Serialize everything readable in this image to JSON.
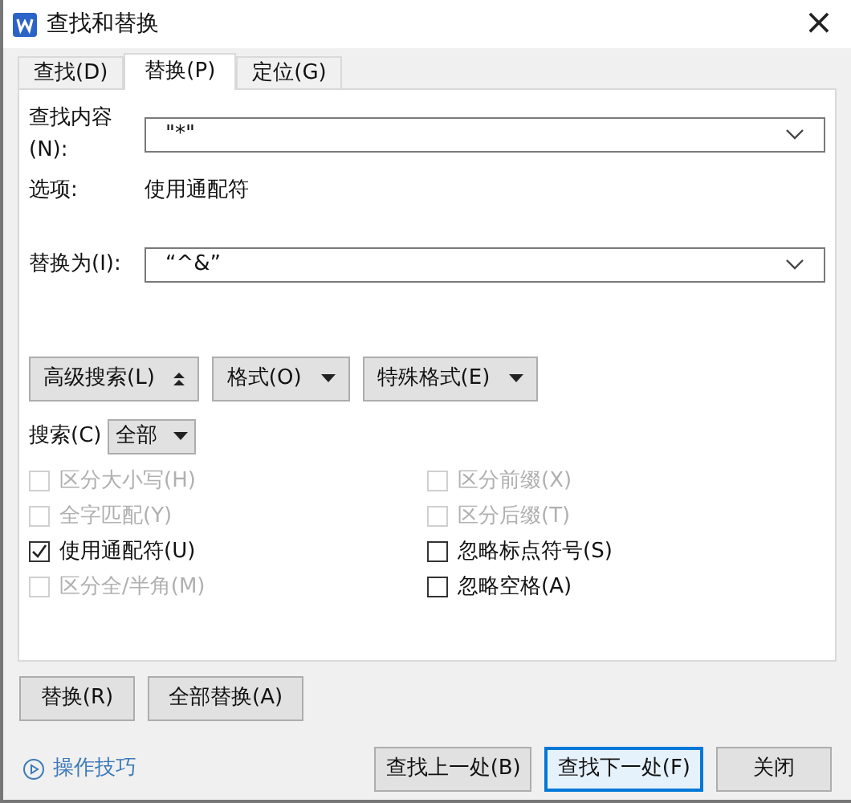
{
  "window": {
    "title": "查找和替换",
    "close": "×"
  },
  "tabs": [
    {
      "label": "查找(D)",
      "selected": false
    },
    {
      "label": "替换(P)",
      "selected": true
    },
    {
      "label": "定位(G)",
      "selected": false
    }
  ],
  "find": {
    "label": "查找内容(N):",
    "value": "\"*\""
  },
  "options": {
    "label": "选项:",
    "value": "使用通配符"
  },
  "replace": {
    "label": "替换为(I):",
    "value": "“^&”"
  },
  "advanced_buttons": [
    {
      "label": "高级搜索(L)",
      "kind": "collapse"
    },
    {
      "label": "格式(O)",
      "kind": "menu"
    },
    {
      "label": "特殊格式(E)",
      "kind": "menu"
    }
  ],
  "search": {
    "label": "搜索(C)",
    "value": "全部"
  },
  "checkboxes_left": [
    {
      "label": "区分大小写(H)",
      "checked": false,
      "disabled": true
    },
    {
      "label": "全字匹配(Y)",
      "checked": false,
      "disabled": true
    },
    {
      "label": "使用通配符(U)",
      "checked": true,
      "disabled": false
    },
    {
      "label": "区分全/半角(M)",
      "checked": false,
      "disabled": true
    }
  ],
  "checkboxes_right": [
    {
      "label": "区分前缀(X)",
      "checked": false,
      "disabled": true
    },
    {
      "label": "区分后缀(T)",
      "checked": false,
      "disabled": true
    },
    {
      "label": "忽略标点符号(S)",
      "checked": false,
      "disabled": false
    },
    {
      "label": "忽略空格(A)",
      "checked": false,
      "disabled": false
    }
  ],
  "replace_buttons": [
    "替换(R)",
    "全部替换(A)"
  ],
  "tips_link": "操作技巧",
  "footer_buttons": [
    {
      "label": "查找上一处(B)",
      "selected": false
    },
    {
      "label": "查找下一处(F)",
      "selected": true
    },
    {
      "label": "关闭",
      "selected": false
    }
  ]
}
